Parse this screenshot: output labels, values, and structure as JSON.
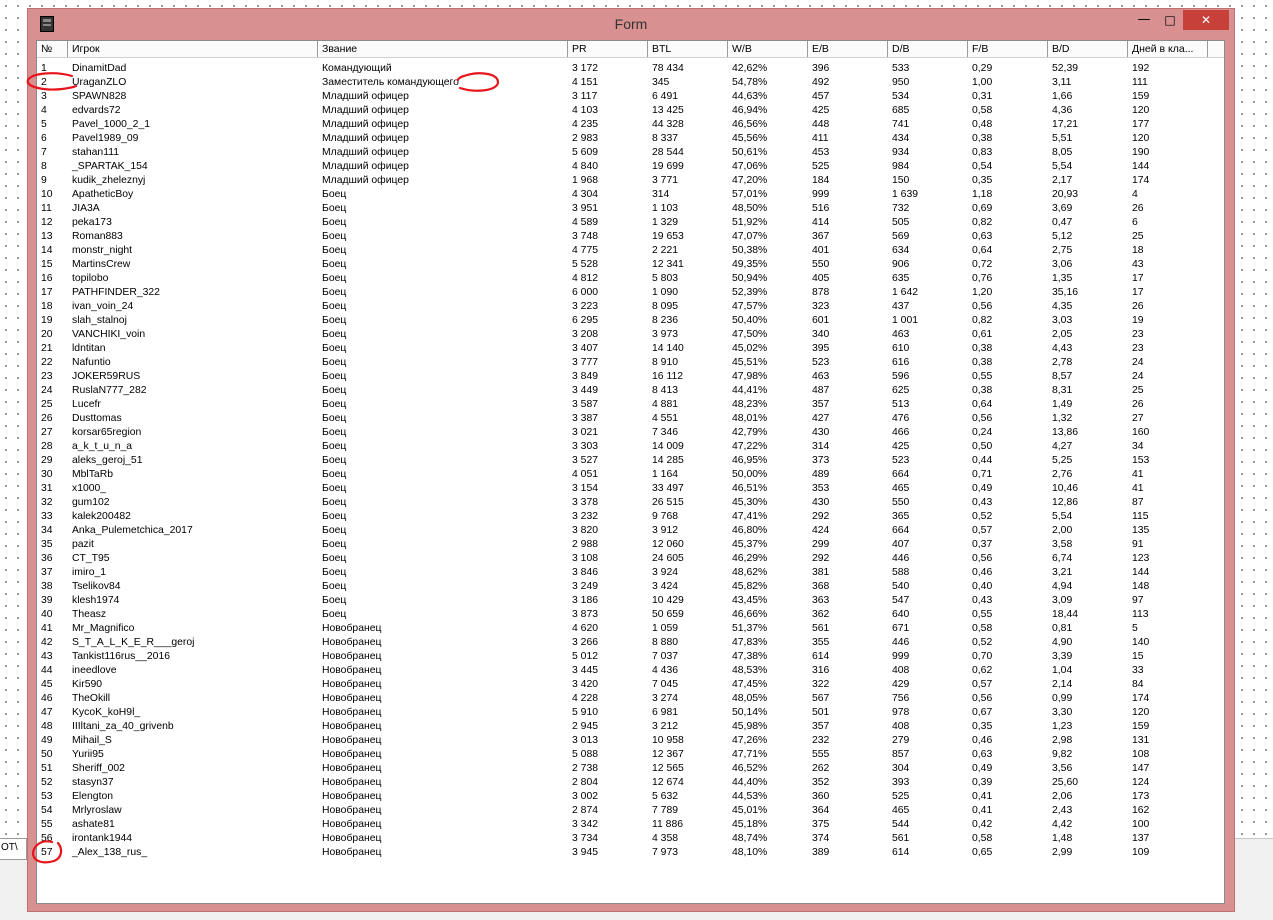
{
  "window": {
    "title": "Form",
    "icon": "app-icon",
    "controls": {
      "minimize": "—",
      "maximize": "□",
      "close": "✕"
    },
    "accent_color": "#d99090",
    "close_color": "#c7403a"
  },
  "background_tab": {
    "label": "OT\\"
  },
  "table": {
    "columns": [
      "№",
      "Игрок",
      "Звание",
      "PR",
      "BTL",
      "W/B",
      "E/B",
      "D/B",
      "F/B",
      "B/D",
      "Дней в кла..."
    ],
    "rows": [
      [
        "1",
        "DinamitDad",
        "Командующий",
        "3 172",
        "78 434",
        "42,62%",
        "396",
        "533",
        "0,29",
        "52,39",
        "192"
      ],
      [
        "2",
        "UraganZLO",
        "Заместитель командующего",
        "4 151",
        "345",
        "54,78%",
        "492",
        "950",
        "1,00",
        "3,11",
        "111"
      ],
      [
        "3",
        "SPAWN828",
        "Младший офицер",
        "3 117",
        "6 491",
        "44,63%",
        "457",
        "534",
        "0,31",
        "1,66",
        "159"
      ],
      [
        "4",
        "edvards72",
        "Младший офицер",
        "4 103",
        "13 425",
        "46,94%",
        "425",
        "685",
        "0,58",
        "4,36",
        "120"
      ],
      [
        "5",
        "Pavel_1000_2_1",
        "Младший офицер",
        "4 235",
        "44 328",
        "46,56%",
        "448",
        "741",
        "0,48",
        "17,21",
        "177"
      ],
      [
        "6",
        "Pavel1989_09",
        "Младший офицер",
        "2 983",
        "8 337",
        "45,56%",
        "411",
        "434",
        "0,38",
        "5,51",
        "120"
      ],
      [
        "7",
        "stahan111",
        "Младший офицер",
        "5 609",
        "28 544",
        "50,61%",
        "453",
        "934",
        "0,83",
        "8,05",
        "190"
      ],
      [
        "8",
        "_SPARTAK_154",
        "Младший офицер",
        "4 840",
        "19 699",
        "47,06%",
        "525",
        "984",
        "0,54",
        "5,54",
        "144"
      ],
      [
        "9",
        "kudik_zheleznyj",
        "Младший офицер",
        "1 968",
        "3 771",
        "47,20%",
        "184",
        "150",
        "0,35",
        "2,17",
        "174"
      ],
      [
        "10",
        "ApatheticBoy",
        "Боец",
        "4 304",
        "314",
        "57,01%",
        "999",
        "1 639",
        "1,18",
        "20,93",
        "4"
      ],
      [
        "11",
        "JIA3A",
        "Боец",
        "3 951",
        "1 103",
        "48,50%",
        "516",
        "732",
        "0,69",
        "3,69",
        "26"
      ],
      [
        "12",
        "peka173",
        "Боец",
        "4 589",
        "1 329",
        "51,92%",
        "414",
        "505",
        "0,82",
        "0,47",
        "6"
      ],
      [
        "13",
        "Roman883",
        "Боец",
        "3 748",
        "19 653",
        "47,07%",
        "367",
        "569",
        "0,63",
        "5,12",
        "25"
      ],
      [
        "14",
        "monstr_night",
        "Боец",
        "4 775",
        "2 221",
        "50,38%",
        "401",
        "634",
        "0,64",
        "2,75",
        "18"
      ],
      [
        "15",
        "MartinsCrew",
        "Боец",
        "5 528",
        "12 341",
        "49,35%",
        "550",
        "906",
        "0,72",
        "3,06",
        "43"
      ],
      [
        "16",
        "topilobo",
        "Боец",
        "4 812",
        "5 803",
        "50,94%",
        "405",
        "635",
        "0,76",
        "1,35",
        "17"
      ],
      [
        "17",
        "PATHFINDER_322",
        "Боец",
        "6 000",
        "1 090",
        "52,39%",
        "878",
        "1 642",
        "1,20",
        "35,16",
        "17"
      ],
      [
        "18",
        "ivan_voin_24",
        "Боец",
        "3 223",
        "8 095",
        "47,57%",
        "323",
        "437",
        "0,56",
        "4,35",
        "26"
      ],
      [
        "19",
        "slah_stalnoj",
        "Боец",
        "6 295",
        "8 236",
        "50,40%",
        "601",
        "1 001",
        "0,82",
        "3,03",
        "19"
      ],
      [
        "20",
        "VANCHIKI_voin",
        "Боец",
        "3 208",
        "3 973",
        "47,50%",
        "340",
        "463",
        "0,61",
        "2,05",
        "23"
      ],
      [
        "21",
        "ldntitan",
        "Боец",
        "3 407",
        "14 140",
        "45,02%",
        "395",
        "610",
        "0,38",
        "4,43",
        "23"
      ],
      [
        "22",
        "Nafuntio",
        "Боец",
        "3 777",
        "8 910",
        "45,51%",
        "523",
        "616",
        "0,38",
        "2,78",
        "24"
      ],
      [
        "23",
        "JOKER59RUS",
        "Боец",
        "3 849",
        "16 112",
        "47,98%",
        "463",
        "596",
        "0,55",
        "8,57",
        "24"
      ],
      [
        "24",
        "RuslaN777_282",
        "Боец",
        "3 449",
        "8 413",
        "44,41%",
        "487",
        "625",
        "0,38",
        "8,31",
        "25"
      ],
      [
        "25",
        "Lucefr",
        "Боец",
        "3 587",
        "4 881",
        "48,23%",
        "357",
        "513",
        "0,64",
        "1,49",
        "26"
      ],
      [
        "26",
        "Dusttomas",
        "Боец",
        "3 387",
        "4 551",
        "48,01%",
        "427",
        "476",
        "0,56",
        "1,32",
        "27"
      ],
      [
        "27",
        "korsar65region",
        "Боец",
        "3 021",
        "7 346",
        "42,79%",
        "430",
        "466",
        "0,24",
        "13,86",
        "160"
      ],
      [
        "28",
        "a_k_t_u_n_a",
        "Боец",
        "3 303",
        "14 009",
        "47,22%",
        "314",
        "425",
        "0,50",
        "4,27",
        "34"
      ],
      [
        "29",
        "aleks_geroj_51",
        "Боец",
        "3 527",
        "14 285",
        "46,95%",
        "373",
        "523",
        "0,44",
        "5,25",
        "153"
      ],
      [
        "30",
        "MblTaRb",
        "Боец",
        "4 051",
        "1 164",
        "50,00%",
        "489",
        "664",
        "0,71",
        "2,76",
        "41"
      ],
      [
        "31",
        "x1000_",
        "Боец",
        "3 154",
        "33 497",
        "46,51%",
        "353",
        "465",
        "0,49",
        "10,46",
        "41"
      ],
      [
        "32",
        "gum102",
        "Боец",
        "3 378",
        "26 515",
        "45,30%",
        "430",
        "550",
        "0,43",
        "12,86",
        "87"
      ],
      [
        "33",
        "kalek200482",
        "Боец",
        "3 232",
        "9 768",
        "47,41%",
        "292",
        "365",
        "0,52",
        "5,54",
        "115"
      ],
      [
        "34",
        "Anka_Pulemetchica_2017",
        "Боец",
        "3 820",
        "3 912",
        "46,80%",
        "424",
        "664",
        "0,57",
        "2,00",
        "135"
      ],
      [
        "35",
        "pazit",
        "Боец",
        "2 988",
        "12 060",
        "45,37%",
        "299",
        "407",
        "0,37",
        "3,58",
        "91"
      ],
      [
        "36",
        "CT_T95",
        "Боец",
        "3 108",
        "24 605",
        "46,29%",
        "292",
        "446",
        "0,56",
        "6,74",
        "123"
      ],
      [
        "37",
        "imiro_1",
        "Боец",
        "3 846",
        "3 924",
        "48,62%",
        "381",
        "588",
        "0,46",
        "3,21",
        "144"
      ],
      [
        "38",
        "Tselikov84",
        "Боец",
        "3 249",
        "3 424",
        "45,82%",
        "368",
        "540",
        "0,40",
        "4,94",
        "148"
      ],
      [
        "39",
        "klesh1974",
        "Боец",
        "3 186",
        "10 429",
        "43,45%",
        "363",
        "547",
        "0,43",
        "3,09",
        "97"
      ],
      [
        "40",
        "Theasz",
        "Боец",
        "3 873",
        "50 659",
        "46,66%",
        "362",
        "640",
        "0,55",
        "18,44",
        "113"
      ],
      [
        "41",
        "Mr_Magnifico",
        "Новобранец",
        "4 620",
        "1 059",
        "51,37%",
        "561",
        "671",
        "0,58",
        "0,81",
        "5"
      ],
      [
        "42",
        "S_T_A_L_K_E_R___geroj",
        "Новобранец",
        "3 266",
        "8 880",
        "47,83%",
        "355",
        "446",
        "0,52",
        "4,90",
        "140"
      ],
      [
        "43",
        "Tankist116rus__2016",
        "Новобранец",
        "5 012",
        "7 037",
        "47,38%",
        "614",
        "999",
        "0,70",
        "3,39",
        "15"
      ],
      [
        "44",
        "ineedlove",
        "Новобранец",
        "3 445",
        "4 436",
        "48,53%",
        "316",
        "408",
        "0,62",
        "1,04",
        "33"
      ],
      [
        "45",
        "Kir590",
        "Новобранец",
        "3 420",
        "7 045",
        "47,45%",
        "322",
        "429",
        "0,57",
        "2,14",
        "84"
      ],
      [
        "46",
        "TheOkill",
        "Новобранец",
        "4 228",
        "3 274",
        "48,05%",
        "567",
        "756",
        "0,56",
        "0,99",
        "174"
      ],
      [
        "47",
        "KycoK_koH9l_",
        "Новобранец",
        "5 910",
        "6 981",
        "50,14%",
        "501",
        "978",
        "0,67",
        "3,30",
        "120"
      ],
      [
        "48",
        "IIIltani_za_40_grivenb",
        "Новобранец",
        "2 945",
        "3 212",
        "45,98%",
        "357",
        "408",
        "0,35",
        "1,23",
        "159"
      ],
      [
        "49",
        "Mihail_S",
        "Новобранец",
        "3 013",
        "10 958",
        "47,26%",
        "232",
        "279",
        "0,46",
        "2,98",
        "131"
      ],
      [
        "50",
        "Yurii95",
        "Новобранец",
        "5 088",
        "12 367",
        "47,71%",
        "555",
        "857",
        "0,63",
        "9,82",
        "108"
      ],
      [
        "51",
        "Sheriff_002",
        "Новобранец",
        "2 738",
        "12 565",
        "46,52%",
        "262",
        "304",
        "0,49",
        "3,56",
        "147"
      ],
      [
        "52",
        "stasyn37",
        "Новобранец",
        "2 804",
        "12 674",
        "44,40%",
        "352",
        "393",
        "0,39",
        "25,60",
        "124"
      ],
      [
        "53",
        "Elengton",
        "Новобранец",
        "3 002",
        "5 632",
        "44,53%",
        "360",
        "525",
        "0,41",
        "2,06",
        "173"
      ],
      [
        "54",
        "Mrlyroslaw",
        "Новобранец",
        "2 874",
        "7 789",
        "45,01%",
        "364",
        "465",
        "0,41",
        "2,43",
        "162"
      ],
      [
        "55",
        "ashate81",
        "Новобранец",
        "3 342",
        "11 886",
        "45,18%",
        "375",
        "544",
        "0,42",
        "4,42",
        "100"
      ],
      [
        "56",
        "irontank1944",
        "Новобранец",
        "3 734",
        "4 358",
        "48,74%",
        "374",
        "561",
        "0,58",
        "1,48",
        "137"
      ],
      [
        "57",
        "_Alex_138_rus_",
        "Новобранец",
        "3 945",
        "7 973",
        "48,10%",
        "389",
        "614",
        "0,65",
        "2,99",
        "109"
      ]
    ]
  },
  "annotations": {
    "color": "#e8141c",
    "shape": "hand-drawn-circles"
  }
}
